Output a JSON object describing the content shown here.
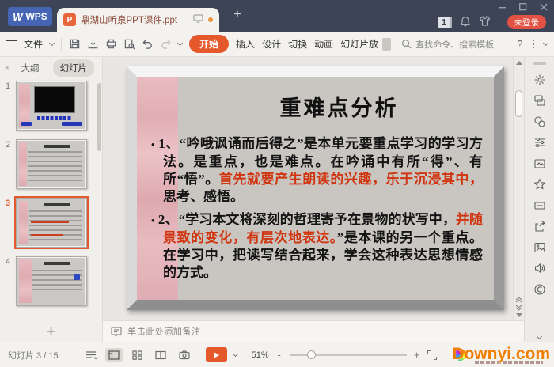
{
  "colors": {
    "accent_orange": "#e4582c",
    "slide_red_text": "#d03510",
    "login_red": "#e25244",
    "watermark_orange": "#f07d00"
  },
  "titlebar": {
    "logo": "WPS",
    "logo_glyph": "W",
    "doc_tab": {
      "title": "鼎湖山听泉PPT课件.ppt"
    },
    "badge_count": "1",
    "login_label": "未登录"
  },
  "ribbon": {
    "file_label": "文件",
    "tabs": [
      {
        "label": "开始"
      },
      {
        "label": "插入"
      },
      {
        "label": "设计"
      },
      {
        "label": "切换"
      },
      {
        "label": "动画"
      },
      {
        "label": "幻灯片放"
      }
    ],
    "search_placeholder": "查找命令、搜索模板",
    "help_label": "?"
  },
  "sidebar": {
    "tabs": [
      {
        "label": "大纲"
      },
      {
        "label": "幻灯片"
      }
    ],
    "thumbnails": [
      {
        "number": "1"
      },
      {
        "number": "2"
      },
      {
        "number": "3"
      },
      {
        "number": "4"
      }
    ],
    "add_slide_label": "+"
  },
  "slide": {
    "title": "重难点分析",
    "bullet_char": "•",
    "bullets": [
      {
        "segments": [
          {
            "text": "1、“吟哦讽诵而后得之”是本单元要重点学习的学习方法。是重点，也是难点。在吟诵中有所“得”、有所“悟”。"
          },
          {
            "text": "首先就要产生朗读的兴趣，乐于沉浸其中，",
            "red": true
          },
          {
            "text": "思考、感悟。"
          }
        ]
      },
      {
        "segments": [
          {
            "text": "2、“学习本文将深刻的哲理寄予在景物的状写中，"
          },
          {
            "text": "并随景致的变化，有层次地表达。",
            "red": true
          },
          {
            "text": "”是本课的另一个重点。在学习中，把读写结合起来，学会这种表达思想情感的方式。"
          }
        ]
      }
    ]
  },
  "notes": {
    "placeholder": "单击此处添加备注"
  },
  "statusbar": {
    "slide_indicator": "幻灯片 3 / 15",
    "zoom_level": "51%",
    "zoom_minus": "-",
    "zoom_plus": "+"
  },
  "watermark": {
    "text": "Downyi.com"
  }
}
